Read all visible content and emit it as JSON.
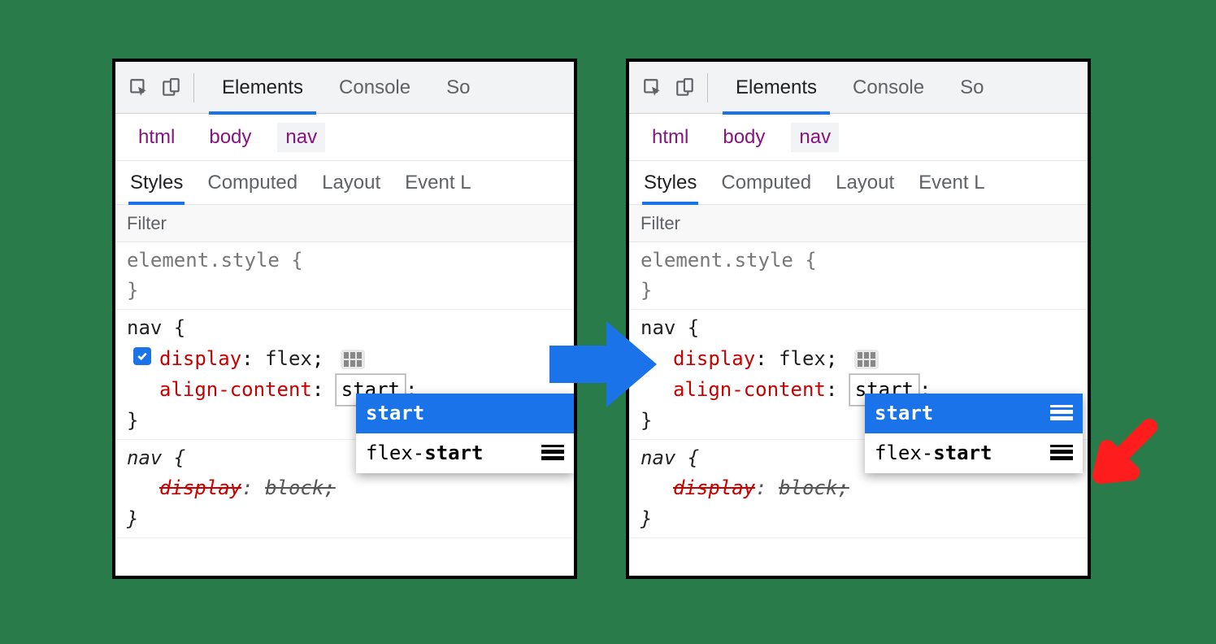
{
  "toolbar_tabs": {
    "elements": "Elements",
    "console": "Console",
    "sources_truncated": "So"
  },
  "breadcrumb": {
    "html": "html",
    "body": "body",
    "nav": "nav"
  },
  "subtabs": {
    "styles": "Styles",
    "computed": "Computed",
    "layout": "Layout",
    "event_truncated": "Event L"
  },
  "filter_placeholder": "Filter",
  "element_style_open": "element.style {",
  "close_brace": "}",
  "nav_open": "nav {",
  "display_prop": "display",
  "display_val": "flex",
  "align_prop": "align-content",
  "align_val": "start",
  "semicolon": ";",
  "colon": ": ",
  "nav_ua_open": "nav {",
  "override_prop": "display",
  "override_val": "block;",
  "dropdown": {
    "start": "start",
    "flex_prefix": "flex-",
    "flex_suffix": "start"
  }
}
